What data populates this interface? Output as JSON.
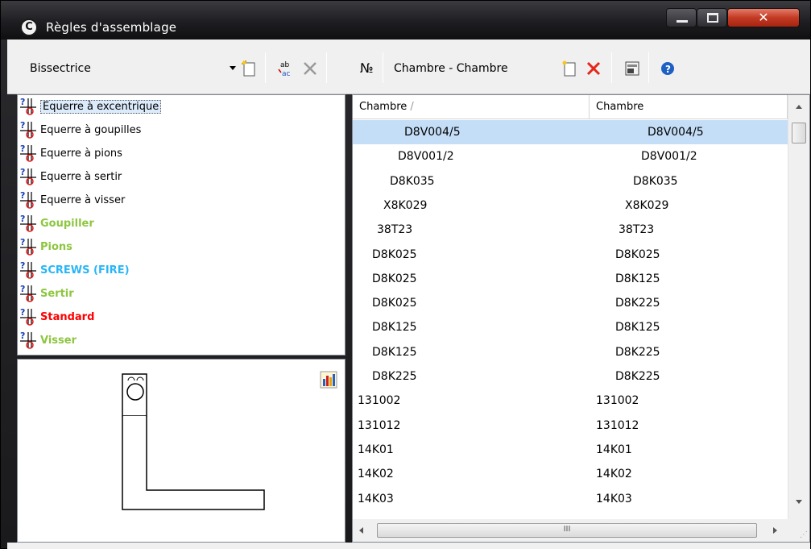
{
  "window": {
    "title": "Règles d'assemblage",
    "app_icon": "C"
  },
  "toolbar": {
    "combo_value": "Bissectrice",
    "pair_label": "Chambre - Chambre",
    "icons": [
      "new-rule-icon",
      "rename-icon",
      "delete-icon",
      "tree-icon",
      "new-pair-icon",
      "delete-pair-icon",
      "properties-icon",
      "help-icon"
    ]
  },
  "rules": [
    {
      "label": "Equerre à excentrique",
      "color": "#000000",
      "bold": false,
      "selected": true
    },
    {
      "label": "Equerre à goupilles",
      "color": "#000000",
      "bold": false
    },
    {
      "label": "Equerre à pions",
      "color": "#000000",
      "bold": false
    },
    {
      "label": "Equerre à sertir",
      "color": "#000000",
      "bold": false
    },
    {
      "label": "Equerre à visser",
      "color": "#000000",
      "bold": false
    },
    {
      "label": "Goupiller",
      "color": "#8dc63f",
      "bold": true
    },
    {
      "label": "Pions",
      "color": "#8dc63f",
      "bold": true
    },
    {
      "label": "SCREWS (FIRE)",
      "color": "#29b6f6",
      "bold": true
    },
    {
      "label": "Sertir",
      "color": "#8dc63f",
      "bold": true
    },
    {
      "label": "Standard",
      "color": "#ff0000",
      "bold": true
    },
    {
      "label": "Visser",
      "color": "#8dc63f",
      "bold": true
    }
  ],
  "grid": {
    "headers": [
      {
        "label": "Chambre",
        "sort": "/"
      },
      {
        "label": "Chambre",
        "sort": ""
      }
    ],
    "rows": [
      {
        "a": "D8V004/5",
        "b": "D8V004/5",
        "indentA": 64,
        "indentB": 70,
        "selected": true
      },
      {
        "a": "D8V001/2",
        "b": "D8V001/2",
        "indentA": 56,
        "indentB": 62
      },
      {
        "a": "D8K035",
        "b": "D8K035",
        "indentA": 46,
        "indentB": 52
      },
      {
        "a": "X8K029",
        "b": "X8K029",
        "indentA": 38,
        "indentB": 42
      },
      {
        "a": "38T23",
        "b": "38T23",
        "indentA": 30,
        "indentB": 34
      },
      {
        "a": "D8K025",
        "b": "D8K025",
        "indentA": 24,
        "indentB": 30
      },
      {
        "a": "D8K025",
        "b": "D8K125",
        "indentA": 24,
        "indentB": 30
      },
      {
        "a": "D8K025",
        "b": "D8K225",
        "indentA": 24,
        "indentB": 30
      },
      {
        "a": "D8K125",
        "b": "D8K125",
        "indentA": 24,
        "indentB": 30
      },
      {
        "a": "D8K125",
        "b": "D8K225",
        "indentA": 24,
        "indentB": 30
      },
      {
        "a": "D8K225",
        "b": "D8K225",
        "indentA": 24,
        "indentB": 30
      },
      {
        "a": "131002",
        "b": "131002",
        "indentA": 6,
        "indentB": 6
      },
      {
        "a": "131012",
        "b": "131012",
        "indentA": 6,
        "indentB": 6
      },
      {
        "a": "14K01",
        "b": "14K01",
        "indentA": 6,
        "indentB": 6
      },
      {
        "a": "14K02",
        "b": "14K02",
        "indentA": 6,
        "indentB": 6
      },
      {
        "a": "14K03",
        "b": "14K03",
        "indentA": 6,
        "indentB": 6
      }
    ],
    "hscroll_thumb_text": "III"
  },
  "colors": {
    "selection": "#c5def7",
    "accent_green": "#8dc63f",
    "accent_blue": "#29b6f6",
    "accent_red": "#ff0000"
  }
}
